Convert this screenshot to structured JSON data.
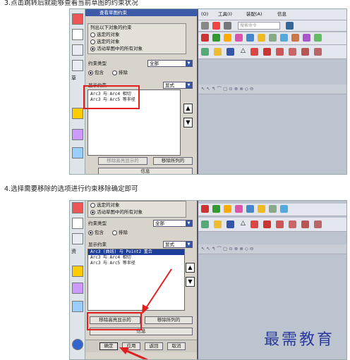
{
  "step3_caption": "3.点击跳转后就能够查看当前草图的约束状况",
  "step4_caption": "4.选择需要移除的选项进行约束移除确定即可",
  "top_dialog": {
    "title": "查看草图约束",
    "group_title": "列出以下对象的约束",
    "radio1": "选定的对象",
    "radio2": "选定的对象",
    "radio3": "活动草图中的所有对象",
    "constraint_type_label": "约束类型",
    "constraint_type_value": "全部",
    "include_label": "包含",
    "exclude_label": "排除",
    "show_label": "显示约束",
    "show_value": "显式",
    "rows": [
      "Arc3 与 Arc4 相切",
      "Arc3 与 Arc5 等半径"
    ],
    "remove_highlighted_button": "移除高亮显示的",
    "remove_listed_button": "移除所列的",
    "info_button": "信息"
  },
  "top_toolbar": {
    "menu_items": [
      "(O)",
      "工具(I)",
      "装配(A)",
      "信息"
    ],
    "command_search_placeholder": "搜索命令"
  },
  "bottom_dialog": {
    "radio2": "选定的对象",
    "radio3": "活动草图中的所有对象",
    "constraint_type_label": "约束类型",
    "constraint_type_value": "全部",
    "include_label": "包含",
    "exclude_label": "排除",
    "show_label": "显示约束",
    "show_value": "显式",
    "rows": [
      "Arc3 (曲线) 与 Point2 重合",
      "Arc3 与 Arc4 相切",
      "Arc3 与 Arc5 等半径"
    ],
    "remove_highlighted_button": "移除高亮显示的",
    "remove_listed_button": "移除所列的",
    "info_button": "信息",
    "ok_button": "确定",
    "apply_button": "应用",
    "back_button": "返回",
    "cancel_button": "取消"
  },
  "side_labels": {
    "top": "草",
    "bottom": "资"
  },
  "watermark": "最需教育",
  "colors": {
    "highlight": "#e02020",
    "selection": "#1c3e9a",
    "watermark": "#2a3a9c"
  }
}
